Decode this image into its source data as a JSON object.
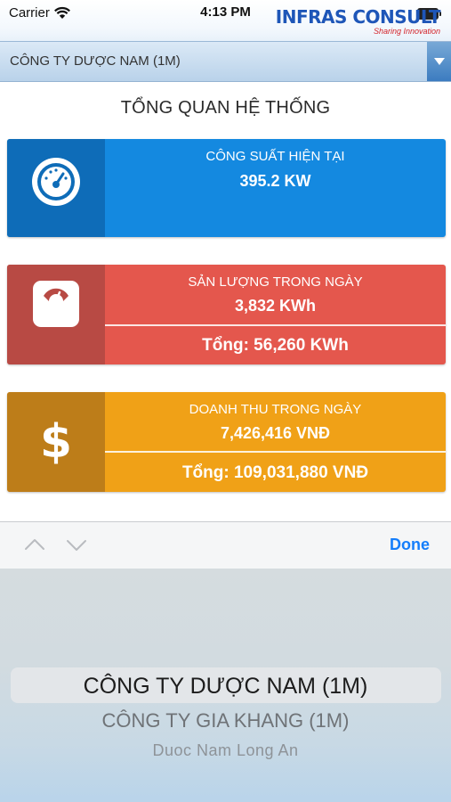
{
  "status_bar": {
    "carrier": "Carrier",
    "time": "4:13 PM"
  },
  "brand": {
    "name": "INFRAS CONSULT",
    "tagline": "Sharing Innovation",
    "color": "#1e56b8",
    "tagline_color": "#d2232a"
  },
  "selector": {
    "selected": "CÔNG TY DƯỢC NAM (1M)"
  },
  "page_title": "TỔNG QUAN HỆ THỐNG",
  "cards": {
    "power": {
      "icon": "gauge-icon",
      "label": "CÔNG SUẤT HIỆN TẠI",
      "value": "395.2 KW",
      "color": "#1489e0"
    },
    "energy": {
      "icon": "scale-icon",
      "label": "SẢN LƯỢNG TRONG NGÀY",
      "value": "3,832 KWh",
      "total": "Tổng: 56,260 KWh",
      "color": "#e4574d"
    },
    "revenue": {
      "icon": "dollar-icon",
      "symbol": "$",
      "label": "DOANH THU TRONG NGÀY",
      "value": "7,426,416 VNĐ",
      "total": "Tổng: 109,031,880 VNĐ",
      "color": "#f0a117"
    }
  },
  "accessory": {
    "done_label": "Done",
    "done_color": "#157efb"
  },
  "picker": {
    "options": [
      "CÔNG TY DƯỢC NAM (1M)",
      "CÔNG TY GIA KHANG (1M)",
      "Duoc Nam Long An"
    ],
    "selected_index": 0
  }
}
